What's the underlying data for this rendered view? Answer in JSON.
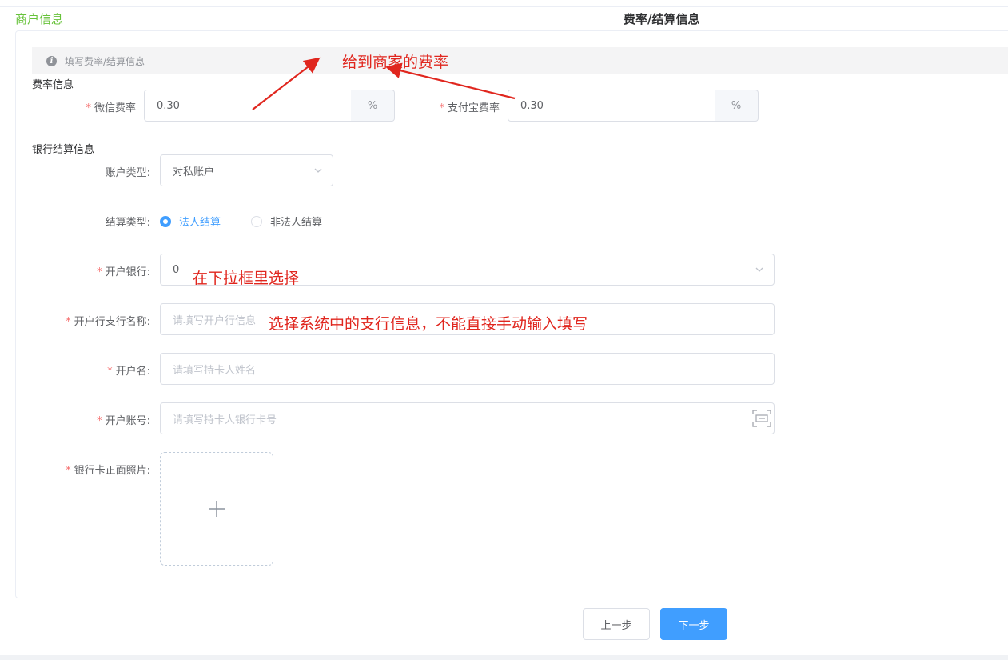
{
  "steps": {
    "merchant_info": "商户信息",
    "rate_settlement": "费率/结算信息"
  },
  "tip": {
    "icon": "info-icon",
    "text": "填写费率/结算信息"
  },
  "rate_section": {
    "title": "费率信息",
    "wechat": {
      "label": "微信费率",
      "value": "0.30",
      "unit": "%"
    },
    "alipay": {
      "label": "支付宝费率",
      "value": "0.30",
      "unit": "%"
    }
  },
  "bank_section": {
    "title": "银行结算信息",
    "account_type": {
      "label": "账户类型:",
      "value": "对私账户"
    },
    "settlement_type": {
      "label": "结算类型:",
      "options": [
        "法人结算",
        "非法人结算"
      ],
      "selected": "法人结算"
    },
    "bank": {
      "label": "开户银行:",
      "value": "0"
    },
    "branch": {
      "label": "开户行支行名称:",
      "placeholder": "请填写开户行信息"
    },
    "account_name": {
      "label": "开户名:",
      "placeholder": "请填写持卡人姓名"
    },
    "account_number": {
      "label": "开户账号:",
      "placeholder": "请填写持卡人银行卡号"
    },
    "card_photo": {
      "label": "银行卡正面照片:"
    }
  },
  "buttons": {
    "prev": "上一步",
    "next": "下一步"
  },
  "annotations": {
    "rate_note": "给到商家的费率",
    "bank_note": "在下拉框里选择",
    "branch_note": "选择系统中的支行信息，不能直接手动输入填写"
  },
  "colors": {
    "primary": "#409eff",
    "success": "#67c23a",
    "required": "#f56c6c",
    "annotation": "#e0261e"
  }
}
